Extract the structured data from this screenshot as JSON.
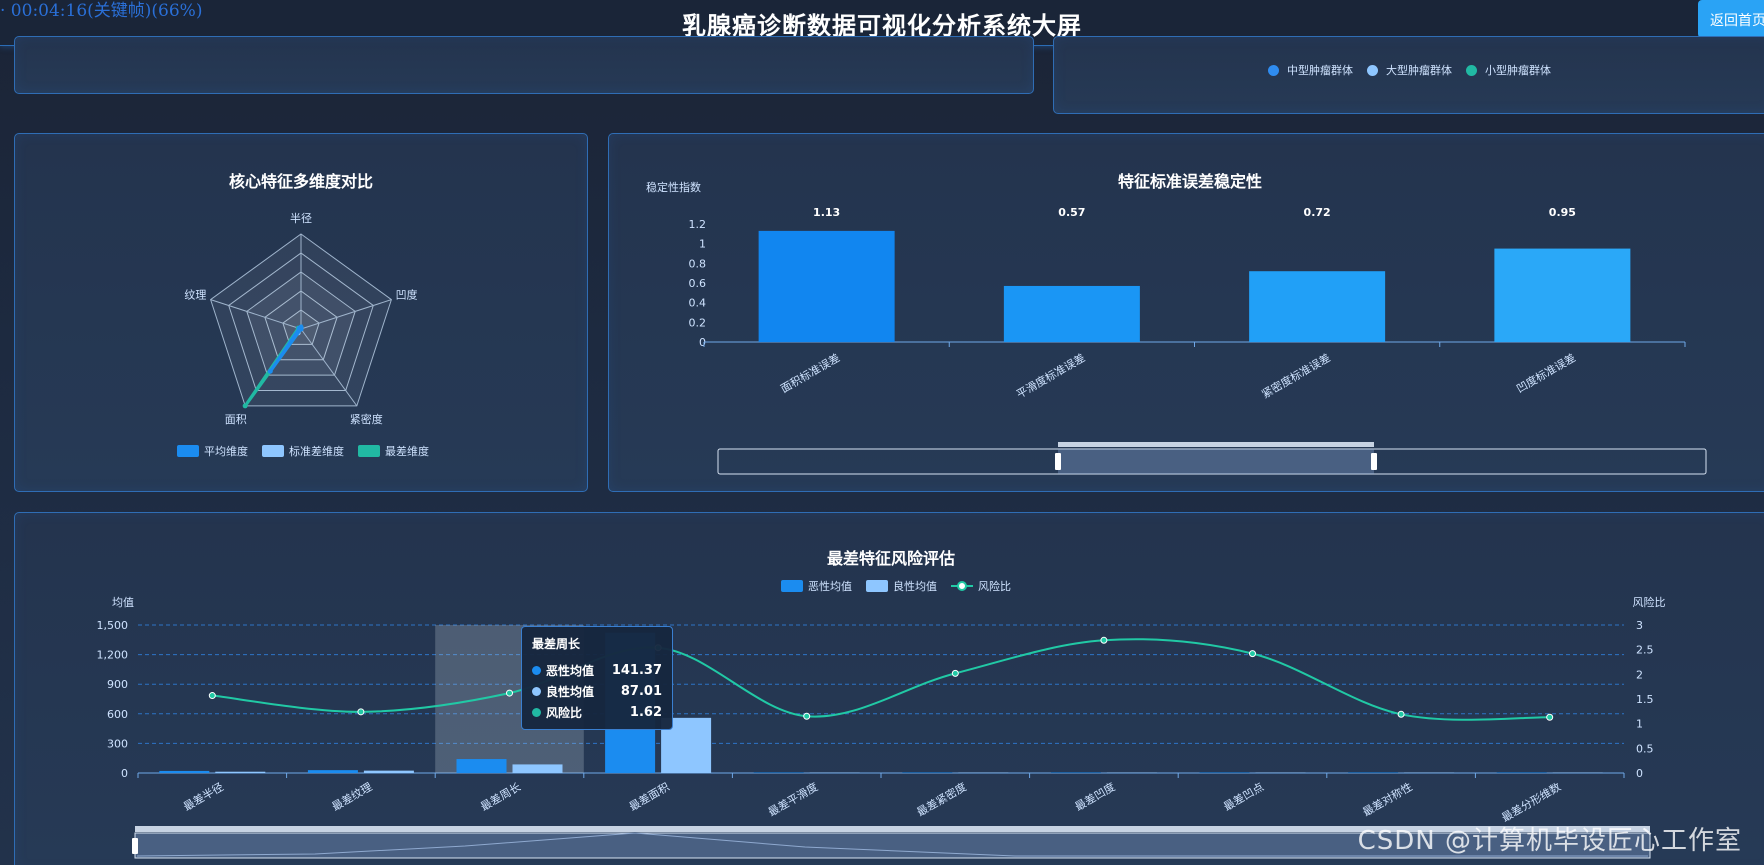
{
  "header": {
    "title": "乳腺癌诊断数据可视化分析系统大屏",
    "recording": "· 00:04:16(关键帧)(66%)",
    "back_button": "返回首页"
  },
  "top_right_legend": [
    {
      "label": "中型肿瘤群体",
      "color": "#2f8cf0"
    },
    {
      "label": "大型肿瘤群体",
      "color": "#8ec6ff"
    },
    {
      "label": "小型肿瘤群体",
      "color": "#21b9a3"
    }
  ],
  "radar": {
    "title": "核心特征多维度对比",
    "axes": [
      "半径",
      "凹度",
      "紧密度",
      "面积",
      "纹理"
    ],
    "legend": [
      {
        "label": "平均维度",
        "color": "#1b8cf0"
      },
      {
        "label": "标准差维度",
        "color": "#8ec6ff"
      },
      {
        "label": "最差维度",
        "color": "#21b9a3"
      }
    ]
  },
  "bars": {
    "title": "特征标准误差稳定性",
    "y_name": "稳定性指数",
    "y_ticks": [
      "1.2",
      "1",
      "0.8",
      "0.6",
      "0.4",
      "0.2",
      "0"
    ],
    "value_labels": [
      "1.13",
      "0.57",
      "0.72",
      "0.95"
    ],
    "categories": [
      "面积标准误差",
      "平滑度标准误差",
      "紧密度标准误差",
      "凹度标准误差"
    ]
  },
  "risk": {
    "title": "最差特征风险评估",
    "legend": [
      {
        "label": "恶性均值",
        "color": "#1b8cf0"
      },
      {
        "label": "良性均值",
        "color": "#8ec6ff"
      },
      {
        "label": "风险比",
        "color": "#21c9a5"
      }
    ],
    "y_left_name": "均值",
    "y_right_name": "风险比",
    "y_left_ticks": [
      "1,500",
      "1,200",
      "900",
      "600",
      "300",
      "0"
    ],
    "y_right_ticks": [
      "3",
      "2.5",
      "2",
      "1.5",
      "1",
      "0.5",
      "0"
    ],
    "categories": [
      "最差半径",
      "最差纹理",
      "最差周长",
      "最差面积",
      "最差平滑度",
      "最差紧密度",
      "最差凹度",
      "最差凹点",
      "最差对称性",
      "最差分形维数"
    ],
    "tooltip": {
      "title": "最差周长",
      "rows": [
        {
          "label": "恶性均值",
          "value": "141.37",
          "color": "#1b8cf0"
        },
        {
          "label": "良性均值",
          "value": "87.01",
          "color": "#8ec6ff"
        },
        {
          "label": "风险比",
          "value": "1.62",
          "color": "#21b9a3"
        }
      ]
    }
  },
  "chart_data": [
    {
      "type": "radar",
      "title": "核心特征多维度对比",
      "axes": [
        "半径",
        "凹度",
        "紧密度",
        "面积",
        "纹理"
      ],
      "series": [
        {
          "name": "平均维度",
          "values": [
            0.02,
            0.0,
            0.0,
            0.55,
            0.02
          ]
        },
        {
          "name": "标准差维度",
          "values": [
            0.0,
            0.0,
            0.0,
            0.05,
            0.0
          ]
        },
        {
          "name": "最差维度",
          "values": [
            0.02,
            0.0,
            0.0,
            1.0,
            0.03
          ]
        }
      ]
    },
    {
      "type": "bar",
      "title": "特征标准误差稳定性",
      "ylabel": "稳定性指数",
      "categories": [
        "面积标准误差",
        "平滑度标准误差",
        "紧密度标准误差",
        "凹度标准误差"
      ],
      "values": [
        1.13,
        0.57,
        0.72,
        0.95
      ],
      "ylim": [
        0,
        1.2
      ]
    },
    {
      "type": "bar",
      "title": "最差特征风险评估",
      "categories": [
        "最差半径",
        "最差纹理",
        "最差周长",
        "最差面积",
        "最差平滑度",
        "最差紧密度",
        "最差凹度",
        "最差凹点",
        "最差对称性",
        "最差分形维数"
      ],
      "series": [
        {
          "name": "恶性均值",
          "values": [
            21,
            29,
            141.37,
            1422,
            0.14,
            0.65,
            0.45,
            0.18,
            0.32,
            0.09
          ]
        },
        {
          "name": "良性均值",
          "values": [
            13,
            24,
            87.01,
            559,
            0.12,
            0.18,
            0.17,
            0.07,
            0.27,
            0.08
          ]
        },
        {
          "name": "风险比",
          "values": [
            1.57,
            1.24,
            1.62,
            2.54,
            1.15,
            2.02,
            2.69,
            2.42,
            1.19,
            1.13
          ]
        }
      ],
      "ylim_left": [
        0,
        1500
      ],
      "ylim_right": [
        0,
        3
      ]
    }
  ]
}
